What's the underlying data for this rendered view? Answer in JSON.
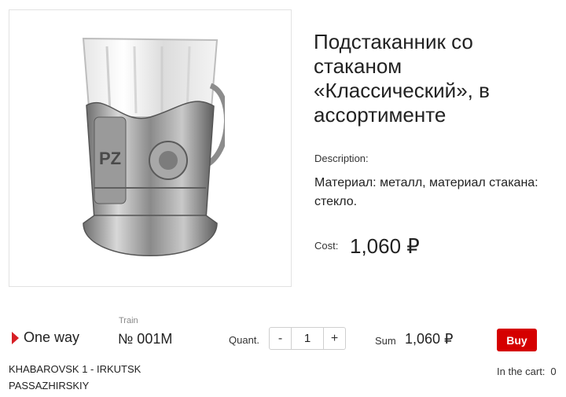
{
  "product": {
    "title": "Подстаканник со стаканом «Классический», в ассортименте",
    "description_label": "Description:",
    "description": "Материал: металл, материал стакана: стекло.",
    "cost_label": "Cost:",
    "cost": "1,060 ₽",
    "image_alt": "glass-holder-with-glass"
  },
  "order": {
    "direction": "One way",
    "train_label": "Train",
    "train_number": "№ 001M",
    "quantity_label": "Quant.",
    "quantity": "1",
    "minus": "-",
    "plus": "+",
    "sum_label": "Sum",
    "sum": "1,060 ₽",
    "buy_label": "Buy",
    "route": "KHABAROVSK 1 - IRKUTSK PASSAZHIRSKIY",
    "cart_label": "In the cart:",
    "cart_count": "0"
  },
  "colors": {
    "accent": "#d50000",
    "triangle": "#d71f26"
  },
  "icons": {
    "direction": "triangle-right-icon"
  }
}
